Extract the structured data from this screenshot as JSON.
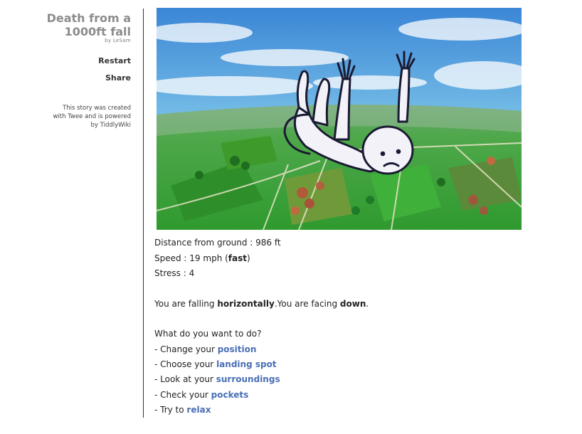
{
  "sidebar": {
    "title_line1": "Death from a",
    "title_line2": "1000ft fall",
    "author": "by LeSam",
    "menu": {
      "restart": "Restart",
      "share": "Share"
    },
    "credits": {
      "line1": "This story was created",
      "line2": "with Twee and is powered",
      "line3": "by TiddlyWiki"
    }
  },
  "status": {
    "distance_label": "Distance from ground : ",
    "distance_value": "986 ft",
    "speed_label": "Speed : ",
    "speed_value": "19 mph (",
    "speed_descriptor": "fast",
    "speed_close": ")",
    "stress_label": "Stress : ",
    "stress_value": "4"
  },
  "orientation": {
    "prefix": "You are falling ",
    "fall_mode": "horizontally",
    "middle": ".You are facing ",
    "facing": "down",
    "suffix": "."
  },
  "prompt": "What do you want to do?",
  "choices": [
    {
      "prefix": "- Change your ",
      "link": "position"
    },
    {
      "prefix": "- Choose your ",
      "link": "landing spot"
    },
    {
      "prefix": "- Look at your ",
      "link": "surroundings"
    },
    {
      "prefix": "- Check your ",
      "link": "pockets"
    },
    {
      "prefix": "- Try to ",
      "link": "relax"
    }
  ],
  "colors": {
    "link": "#4a6fb5",
    "title": "#8c8c8c",
    "sky_top": "#3b86d6",
    "sky_bottom": "#bfe6f0",
    "field_green": "#3ba43a",
    "character": "#f2f2f8"
  },
  "image": {
    "subject": "falling-character-illustration"
  }
}
